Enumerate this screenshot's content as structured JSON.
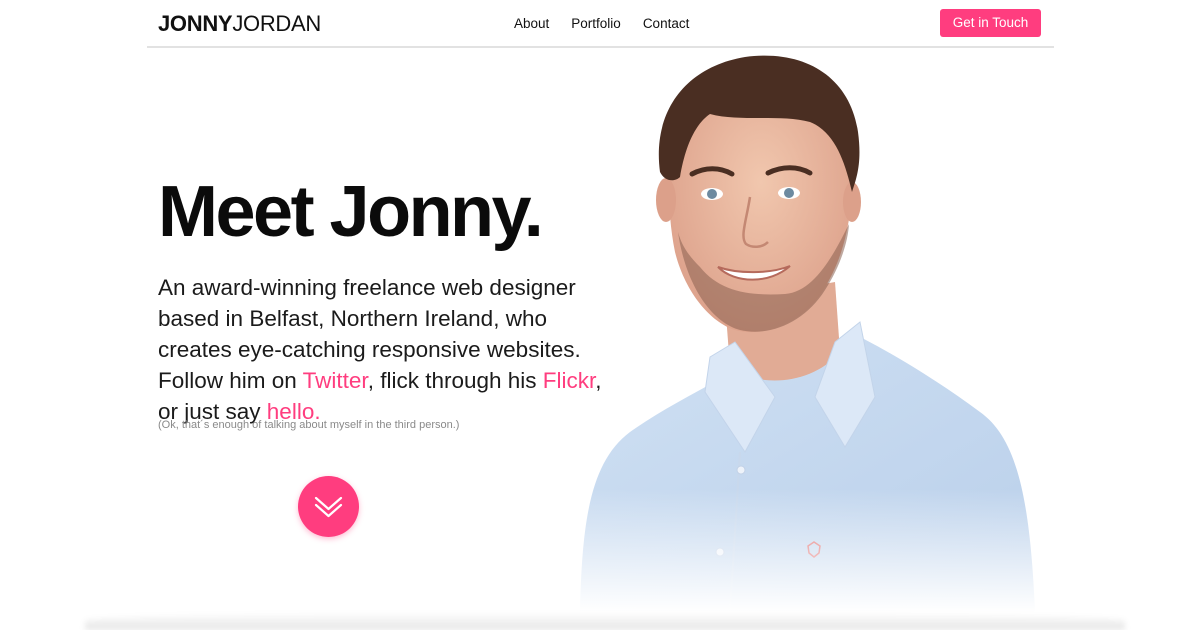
{
  "header": {
    "logo_bold": "JONNY",
    "logo_light": "JORDAN",
    "nav": [
      {
        "label": "About"
      },
      {
        "label": "Portfolio"
      },
      {
        "label": "Contact"
      }
    ],
    "cta_label": "Get in Touch"
  },
  "hero": {
    "headline": "Meet Jonny.",
    "intro_part1": "An award-winning freelance web designer based in Belfast, Northern Ireland, who creates eye-catching responsive websites. Follow him on ",
    "link_twitter": "Twitter",
    "intro_part2": ", flick through his ",
    "link_flickr": "Flickr",
    "intro_part3": ", or just say ",
    "link_hello": "hello.",
    "aside": "(Ok, that´s enough of talking about myself in the third person.)",
    "scroll_icon": "double-chevron-down-icon"
  },
  "colors": {
    "accent": "#ff3d7f",
    "text": "#111111",
    "muted": "#8a8a8a"
  }
}
